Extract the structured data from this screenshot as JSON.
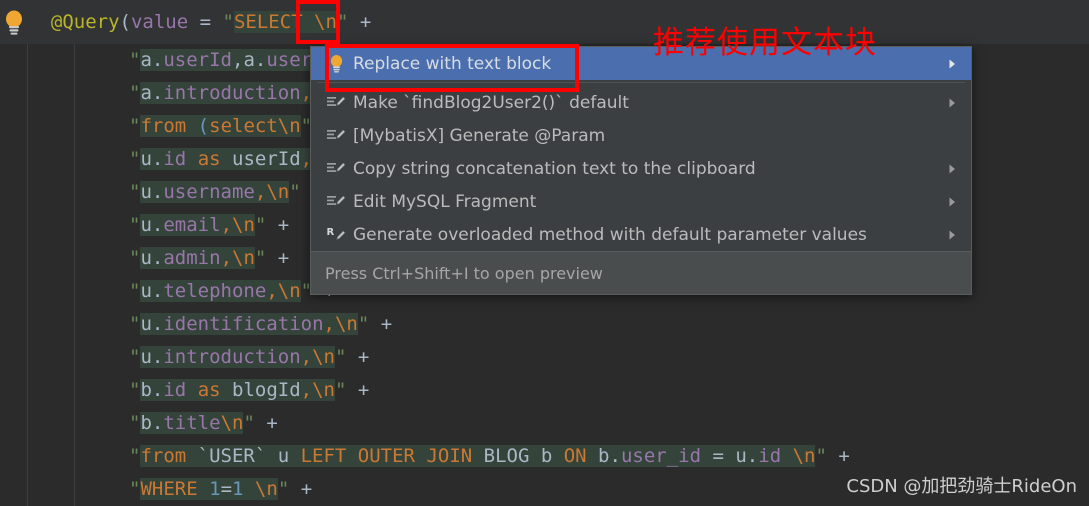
{
  "editor": {
    "gutter_icon": "lightbulb-icon",
    "top_line": {
      "annotation": "@Query",
      "paren_open": "(",
      "param": "value",
      "equals": " = ",
      "quote": "\"",
      "sql": "SELECT ",
      "escape": "\\n",
      "quote_end": "\"",
      "plus": " +"
    },
    "lines": [
      {
        "text": "\"a.userId,a.username,\\n\" +"
      },
      {
        "text": "\"a.introduction,\\n\" +"
      },
      {
        "text": "\"from (select\\n\" +"
      },
      {
        "text": "\"u.id as userId,\\n\" +"
      },
      {
        "text": "\"u.username,\\n\" +"
      },
      {
        "text": "\"u.email,\\n\" +"
      },
      {
        "text": "\"u.admin,\\n\" +"
      },
      {
        "text": "\"u.telephone,\\n\" +"
      },
      {
        "text": "\"u.identification,\\n\" +"
      },
      {
        "text": "\"u.introduction,\\n\" +"
      },
      {
        "text": "\"b.id as blogId,\\n\" +"
      },
      {
        "text": "\"b.title\\n\" +"
      },
      {
        "text": "\"from `USER` u LEFT OUTER JOIN BLOG b ON b.user_id = u.id \\n\" +"
      },
      {
        "text": "\"WHERE 1=1 \\n\" +"
      }
    ]
  },
  "menu": {
    "items": [
      {
        "label": "Replace with text block",
        "icon": "lightbulb-icon",
        "selected": true,
        "has_submenu": true
      },
      {
        "label": "Make `findBlog2User2()` default",
        "icon": "edit-pencil-icon",
        "selected": false,
        "has_submenu": true
      },
      {
        "label": "[MybatisX] Generate @Param",
        "icon": "edit-pencil-icon",
        "selected": false,
        "has_submenu": false
      },
      {
        "label": "Copy string concatenation text to the clipboard",
        "icon": "edit-pencil-icon",
        "selected": false,
        "has_submenu": true
      },
      {
        "label": "Edit MySQL Fragment",
        "icon": "edit-pencil-icon",
        "selected": false,
        "has_submenu": true
      },
      {
        "label": "Generate overloaded method with default parameter values",
        "icon": "refactor-pencil-icon",
        "selected": false,
        "has_submenu": true
      }
    ],
    "footer": "Press Ctrl+Shift+I to open preview"
  },
  "annotations": {
    "note_text": "推荐使用文本块",
    "note_color": "#ff0000",
    "box_color": "#ff0000"
  },
  "watermark": "CSDN @加把劲骑士RideOn",
  "colors": {
    "editor_bg": "#2b2b2b",
    "topbar_bg": "#313335",
    "menu_bg": "#3c3f41",
    "menu_selected_bg": "#4b6eaf",
    "menu_footer_bg": "#4a4d4e",
    "string_green": "#6a8759",
    "keyword_orange": "#cc7832",
    "field_purple": "#9876aa",
    "default_text": "#a9b7c6",
    "annotation_yellow": "#bbb529",
    "number_blue": "#6897bb",
    "injected_sql_bg": "#35443a"
  }
}
